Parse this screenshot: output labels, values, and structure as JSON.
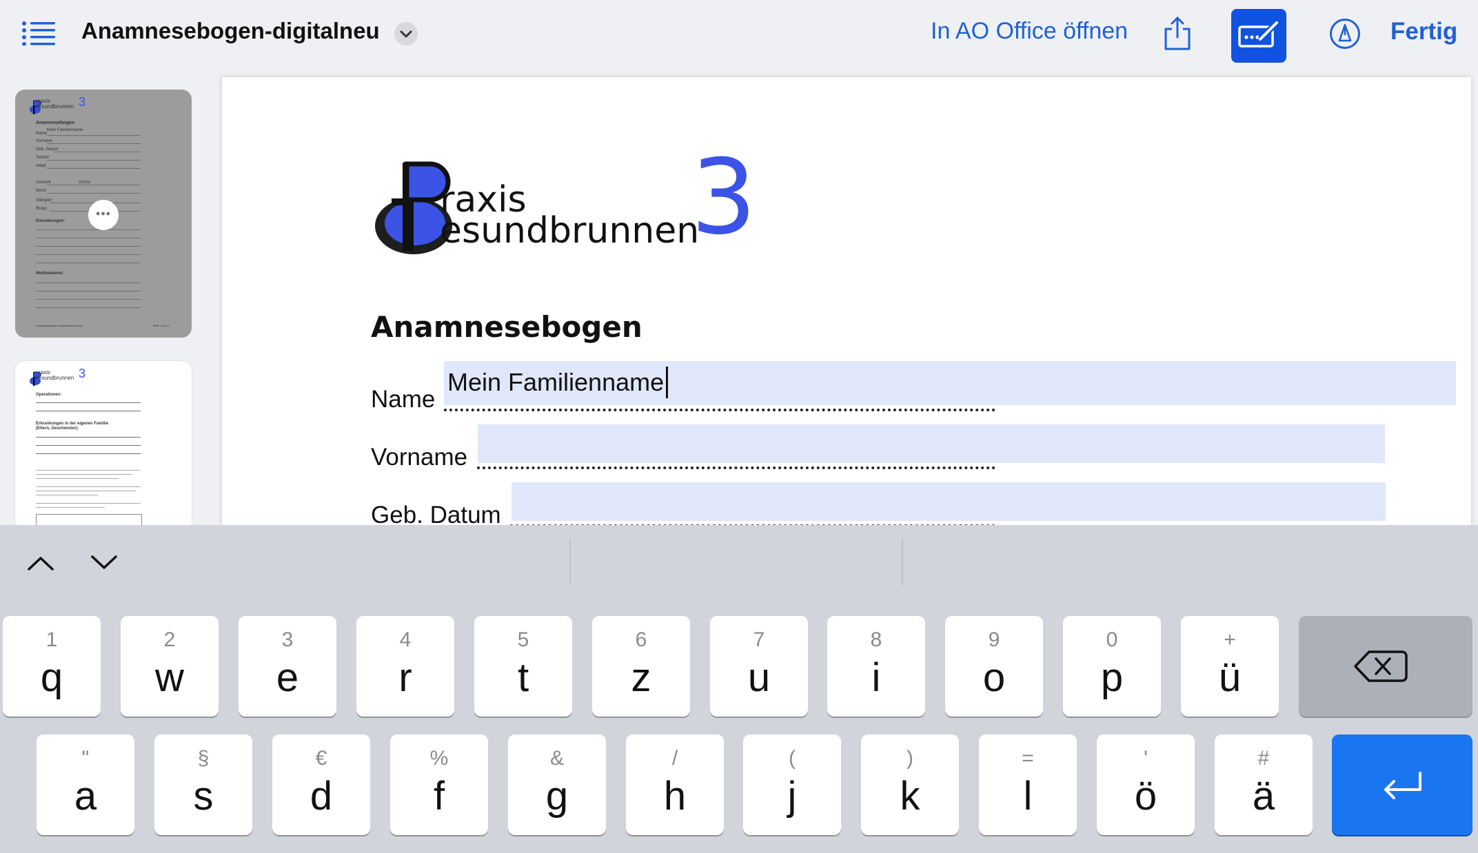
{
  "toolbar": {
    "document_title": "Anamnesebogen-digitalneu",
    "open_in_app": "In AO Office öffnen",
    "done": "Fertig"
  },
  "thumbnails": {
    "page1": {
      "logo_top": "raxis",
      "logo_bottom": "esundbrunnen",
      "logo_number": "3",
      "heading": "Anamnesebogen",
      "name_value": "Mein Familienname",
      "lines": [
        "Name",
        "Vorname",
        "Geb. Datum",
        "Telefon",
        "eMail",
        "Gewicht",
        "Größe",
        "Beruf",
        "Allergien",
        "Blutgr.",
        "Erkrankungen:",
        "Medikamente:"
      ],
      "footer_left": "Anamnesebogen Gesundheitszentrum",
      "footer_right": "Seite 1 von 2"
    },
    "page2": {
      "logo_top": "raxis",
      "logo_bottom": "esundbrunnen",
      "logo_number": "3",
      "section1": "Operationen:",
      "section2": "Erkrankungen in der eigenen Familie",
      "section2b": "(Eltern, Geschwister):"
    }
  },
  "document": {
    "logo": {
      "line1": "raxis",
      "line2": "esundbrunnen",
      "number": "3"
    },
    "heading": "Anamnesebogen",
    "fields": [
      {
        "label": "Name",
        "value": "Mein Familienname"
      },
      {
        "label": "Vorname",
        "value": ""
      },
      {
        "label": "Geb. Datum",
        "value": ""
      }
    ]
  },
  "keyboard": {
    "row1": [
      {
        "main": "q",
        "alt": "1"
      },
      {
        "main": "w",
        "alt": "2"
      },
      {
        "main": "e",
        "alt": "3"
      },
      {
        "main": "r",
        "alt": "4"
      },
      {
        "main": "t",
        "alt": "5"
      },
      {
        "main": "z",
        "alt": "6"
      },
      {
        "main": "u",
        "alt": "7"
      },
      {
        "main": "i",
        "alt": "8"
      },
      {
        "main": "o",
        "alt": "9"
      },
      {
        "main": "p",
        "alt": "0"
      },
      {
        "main": "ü",
        "alt": "+"
      }
    ],
    "row2": [
      {
        "main": "a",
        "alt": "\""
      },
      {
        "main": "s",
        "alt": "§"
      },
      {
        "main": "d",
        "alt": "€"
      },
      {
        "main": "f",
        "alt": "%"
      },
      {
        "main": "g",
        "alt": "&"
      },
      {
        "main": "h",
        "alt": "/"
      },
      {
        "main": "j",
        "alt": "("
      },
      {
        "main": "k",
        "alt": ")"
      },
      {
        "main": "l",
        "alt": "="
      },
      {
        "main": "ö",
        "alt": "'"
      },
      {
        "main": "ä",
        "alt": "#"
      }
    ]
  },
  "colors": {
    "accent": "#1f61d6",
    "markup_active": "#1053e0",
    "logo_blue": "#3b54e6",
    "field_fill": "#e1e7fa",
    "return_key": "#1a75f1"
  }
}
